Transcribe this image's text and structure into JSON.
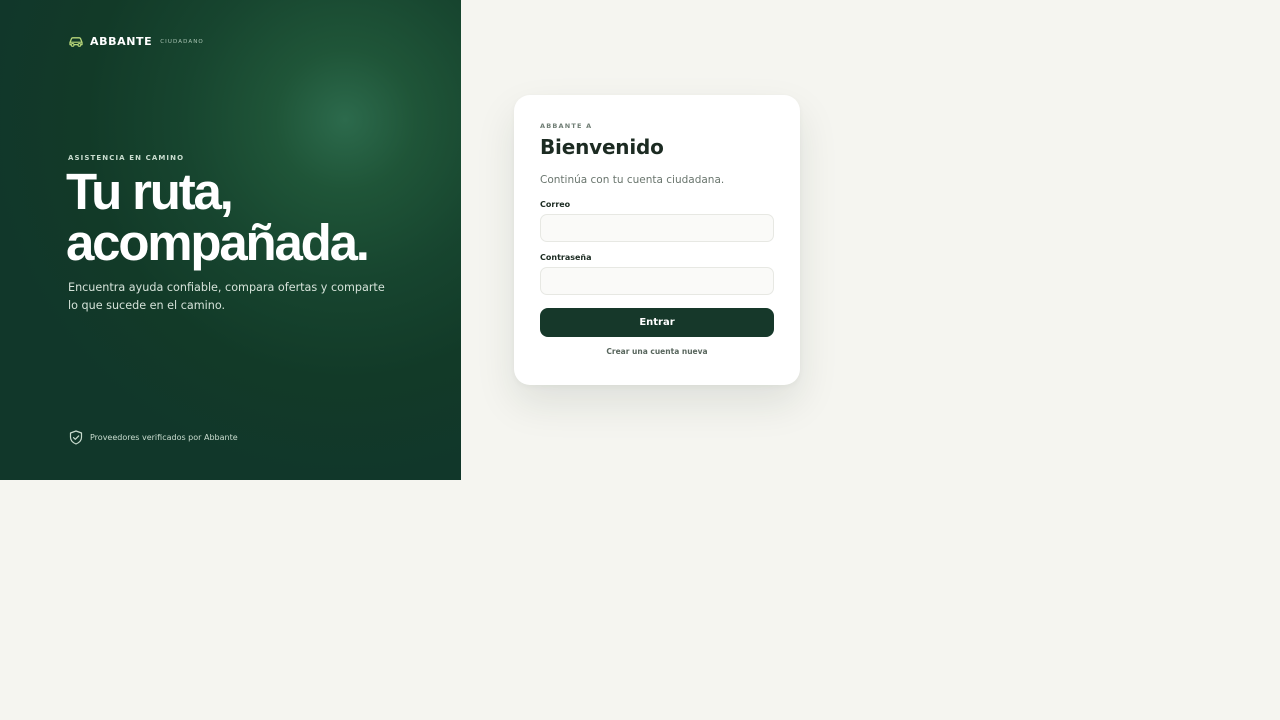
{
  "brand": {
    "name": "ABBANTE",
    "subtitle": "CIUDADANO",
    "icon": "car-icon"
  },
  "hero": {
    "eyebrow": "ASISTENCIA EN CAMINO",
    "headline_line1": "Tu ruta,",
    "headline_line2": "acompañada.",
    "lead": "Encuentra ayuda confiable, compara ofertas y comparte lo que sucede en el camino.",
    "footnote": "Proveedores verificados por Abbante",
    "footnote_icon": "shield-check-icon"
  },
  "login": {
    "eyebrow": "ABBANTE A",
    "title": "Bienvenido",
    "subtitle": "Continúa con tu cuenta ciudadana.",
    "email_label": "Correo",
    "email_value": "",
    "password_label": "Contraseña",
    "password_value": "",
    "submit_label": "Entrar",
    "create_account_label": "Crear una cuenta nueva"
  },
  "colors": {
    "hero_bg": "#123a28",
    "accent": "#16382a",
    "brand_icon": "#b9d77a",
    "page_bg": "#f5f5f0"
  }
}
